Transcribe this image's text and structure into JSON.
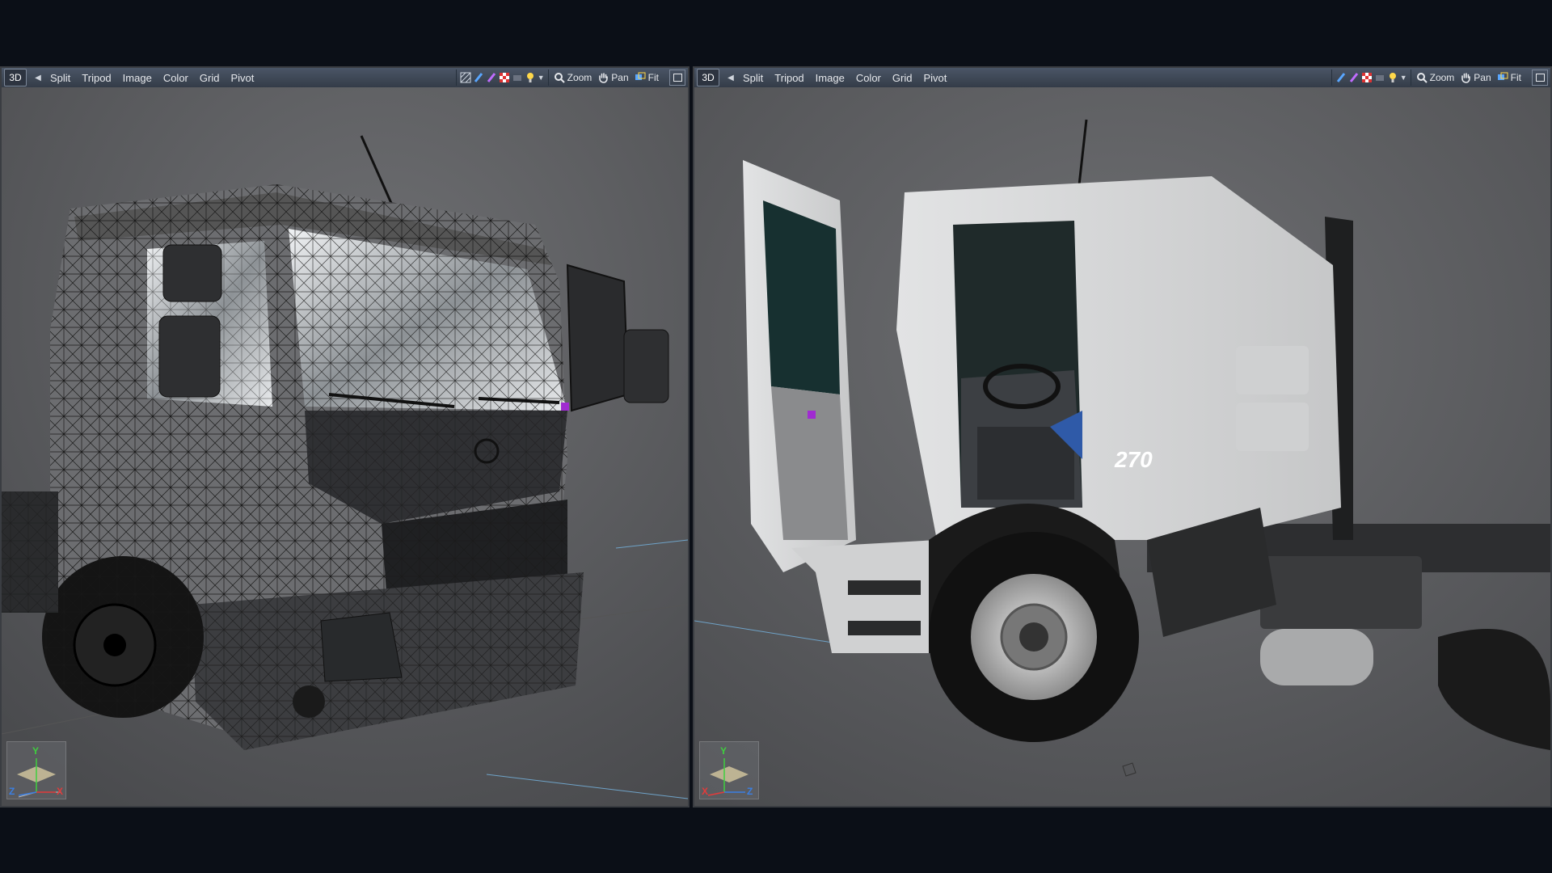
{
  "left_viewport": {
    "mode": "3D",
    "menu": [
      "Split",
      "Tripod",
      "Image",
      "Color",
      "Grid",
      "Pivot"
    ],
    "nav": {
      "zoom": "Zoom",
      "pan": "Pan",
      "fit": "Fit"
    },
    "axes": {
      "y": "Y",
      "z": "Z",
      "x": "X"
    },
    "shading": "wireframe"
  },
  "right_viewport": {
    "mode": "3D",
    "menu": [
      "Split",
      "Tripod",
      "Image",
      "Color",
      "Grid",
      "Pivot"
    ],
    "nav": {
      "zoom": "Zoom",
      "pan": "Pan",
      "fit": "Fit"
    },
    "axes": {
      "y": "Y",
      "x": "X",
      "z": "Z"
    },
    "shading": "solid"
  },
  "colors": {
    "background": "#0b0f17",
    "viewport_bg": "#2b2d30",
    "toolbar": "#3e4756",
    "axis_y": "#3fcf3f",
    "axis_x": "#e23b3b",
    "axis_z": "#3b7fe2"
  },
  "icons": [
    "left-arrow-icon",
    "render-mode-icon",
    "light-icon",
    "zoom-icon",
    "pan-hand-icon",
    "fit-icon",
    "maximize-icon"
  ]
}
